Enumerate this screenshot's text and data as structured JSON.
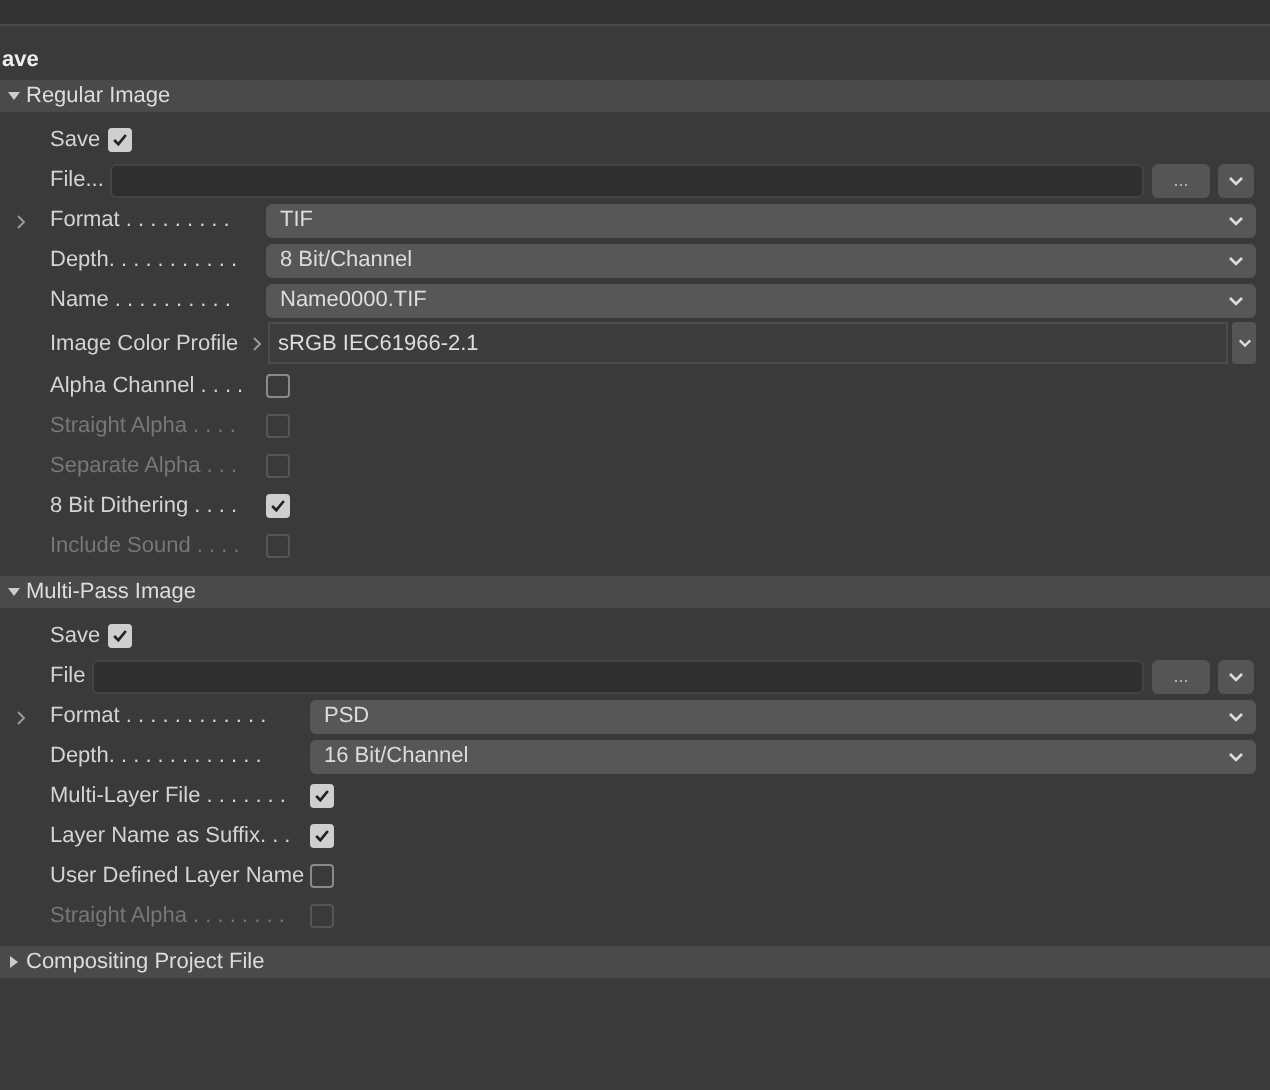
{
  "title": "ave",
  "sections": [
    {
      "title": "Regular Image",
      "expanded": true,
      "rows": [
        {
          "kind": "inline-checkbox",
          "label": "Save",
          "checked": true,
          "disabled": false
        },
        {
          "kind": "file",
          "label": "File...",
          "button": "..."
        },
        {
          "kind": "dropdown",
          "label": "Format . . . . . . . . .",
          "value": "TIF",
          "expandable": true
        },
        {
          "kind": "dropdown",
          "label": "Depth. . . . . . . . . . .",
          "value": "8 Bit/Channel",
          "expandable": false
        },
        {
          "kind": "dropdown",
          "label": "Name . . . . . . . . . .",
          "value": "Name0000.TIF",
          "expandable": false
        },
        {
          "kind": "profile",
          "label": "Image Color Profile",
          "value": "sRGB IEC61966-2.1"
        },
        {
          "kind": "checkbox",
          "label": "Alpha Channel . . . .",
          "checked": false,
          "disabled": false
        },
        {
          "kind": "checkbox",
          "label": "Straight Alpha . . . .",
          "checked": false,
          "disabled": true
        },
        {
          "kind": "checkbox",
          "label": "Separate Alpha  . . .",
          "checked": false,
          "disabled": true
        },
        {
          "kind": "checkbox",
          "label": "8 Bit Dithering . . . .",
          "checked": true,
          "disabled": false
        },
        {
          "kind": "checkbox",
          "label": "Include Sound . . . .",
          "checked": false,
          "disabled": true
        }
      ]
    },
    {
      "title": "Multi-Pass Image",
      "expanded": true,
      "rows": [
        {
          "kind": "inline-checkbox",
          "label": "Save",
          "checked": true,
          "disabled": false
        },
        {
          "kind": "file",
          "label": "File",
          "button": "..."
        },
        {
          "kind": "dropdown",
          "label": "Format . . . . . . . . . . . .",
          "value": "PSD",
          "expandable": true
        },
        {
          "kind": "dropdown",
          "label": "Depth. . . . . . . . . . . . .",
          "value": "16 Bit/Channel",
          "expandable": false
        },
        {
          "kind": "checkbox",
          "label": "Multi-Layer File . . . . . . .",
          "checked": true,
          "disabled": false
        },
        {
          "kind": "checkbox",
          "label": "Layer Name as Suffix. . .",
          "checked": true,
          "disabled": false
        },
        {
          "kind": "checkbox",
          "label": "User Defined Layer Name",
          "checked": false,
          "disabled": false
        },
        {
          "kind": "checkbox",
          "label": "Straight Alpha . . . . . . . .",
          "checked": false,
          "disabled": true
        }
      ]
    },
    {
      "title": "Compositing Project File",
      "expanded": false
    }
  ]
}
